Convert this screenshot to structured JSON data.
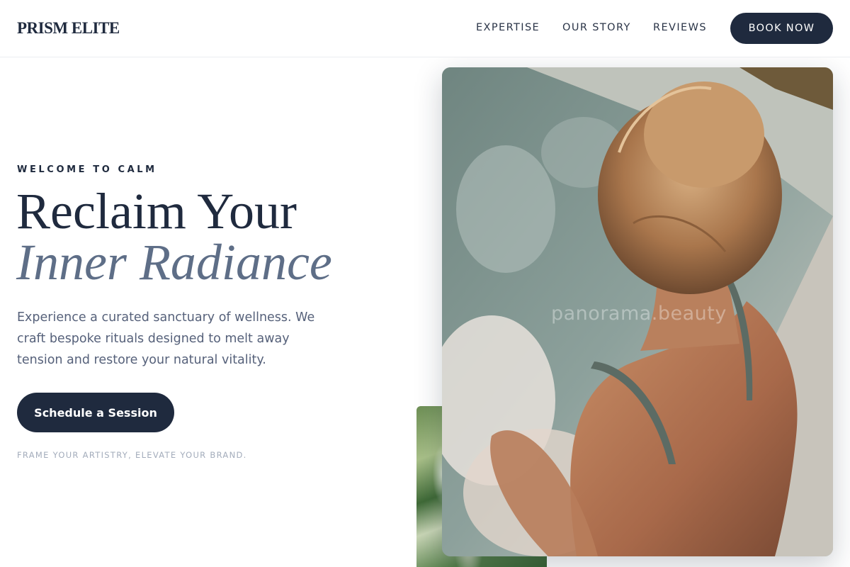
{
  "header": {
    "logo": "PRISM ELITE",
    "nav": [
      "EXPERTISE",
      "OUR STORY",
      "REVIEWS"
    ],
    "book_label": "BOOK NOW"
  },
  "hero": {
    "eyebrow": "WELCOME TO CALM",
    "headline_line1": "Reclaim Your",
    "headline_line2": "Inner Radiance",
    "intro": "Experience a curated sanctuary of wellness. We craft bespoke rituals designed to melt away tension and restore your natural vitality.",
    "cta_label": "Schedule a Session",
    "tagline": "FRAME YOUR ARTISTRY, ELEVATE YOUR BRAND."
  },
  "media": {
    "watermark": "panorama.beauty"
  },
  "colors": {
    "brand_navy": "#1f2a3e",
    "accent_slate": "#5e6e87",
    "body_text": "#56617a",
    "muted_text": "#a3acbb"
  }
}
